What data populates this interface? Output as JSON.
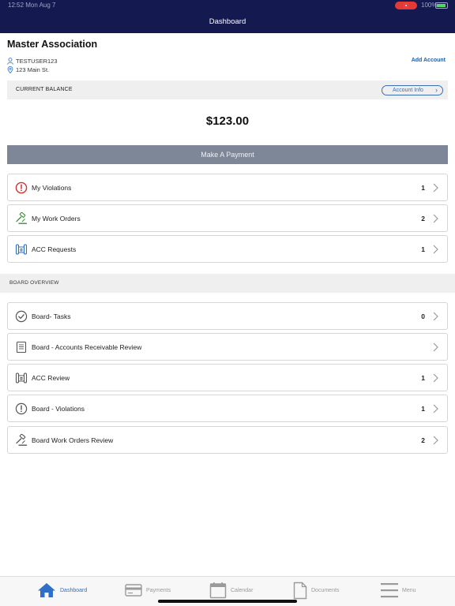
{
  "status_bar": {
    "time": "12:52 Mon Aug 7",
    "battery": "100%"
  },
  "nav": {
    "title": "Dashboard"
  },
  "account": {
    "association": "Master Association",
    "username": "TESTUSER123",
    "address": "123 Main St.",
    "add_account_label": "Add Account"
  },
  "balance": {
    "label": "CURRENT BALANCE",
    "account_info_label": "Account Info",
    "amount": "$123.00"
  },
  "payment": {
    "button_label": "Make A Payment"
  },
  "items": [
    {
      "label": "My Violations",
      "count": "1",
      "icon": "alert-circle-icon"
    },
    {
      "label": "My Work Orders",
      "count": "2",
      "icon": "gavel-icon"
    },
    {
      "label": "ACC Requests",
      "count": "1",
      "icon": "blueprint-icon"
    }
  ],
  "board": {
    "header": "BOARD OVERVIEW",
    "items": [
      {
        "label": "Board- Tasks",
        "count": "0",
        "icon": "check-circle-icon"
      },
      {
        "label": "Board - Accounts Receivable Review",
        "count": "",
        "icon": "ledger-icon"
      },
      {
        "label": "ACC Review",
        "count": "1",
        "icon": "blueprint-icon"
      },
      {
        "label": "Board - Violations",
        "count": "1",
        "icon": "alert-circle-icon"
      },
      {
        "label": "Board Work Orders Review",
        "count": "2",
        "icon": "gavel-icon"
      }
    ]
  },
  "tabs": [
    {
      "label": "Dashboard",
      "icon": "home-icon",
      "active": true
    },
    {
      "label": "Payments",
      "icon": "card-icon",
      "active": false
    },
    {
      "label": "Calendar",
      "icon": "calendar-icon",
      "active": false
    },
    {
      "label": "Documents",
      "icon": "document-icon",
      "active": false
    },
    {
      "label": "Menu",
      "icon": "menu-icon",
      "active": false
    }
  ],
  "colors": {
    "nav_background": "#141a4f",
    "accent_blue": "#2f6fc7",
    "alert_red": "#d32f2f",
    "work_order_green": "#3a8f3a",
    "pay_button": "#7d8797"
  }
}
